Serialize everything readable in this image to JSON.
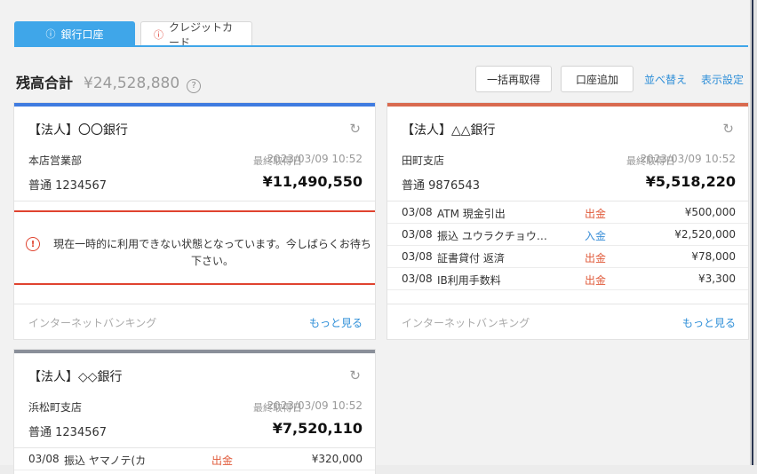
{
  "tabs": [
    {
      "label": "銀行口座",
      "icon": "info-icon",
      "active": true
    },
    {
      "label": "クレジットカード",
      "icon": "alert-icon",
      "active": false
    }
  ],
  "summary": {
    "label": "残高合計",
    "amount": "¥24,528,880",
    "help_icon": "question-icon"
  },
  "actions": {
    "refetch_all": "一括再取得",
    "add_account": "口座追加",
    "sort": "並べ替え",
    "display_settings": "表示設定"
  },
  "colors": {
    "accent": "#3fa6e9",
    "card1": "#3f7be0",
    "card2": "#d96a4f",
    "card3": "#8a8f99",
    "error": "#e0432f",
    "withdrawal": "#e05a3a",
    "deposit": "#3b8fd8"
  },
  "cards": [
    {
      "title": "【法人】〇〇銀行",
      "branch": "本店営業部",
      "last_fetched_label": "最終取得日",
      "last_fetched": "2023/03/09 10:52",
      "account": "普通 1234567",
      "balance": "¥11,490,550",
      "error_message": "現在一時的に利用できない状態となっています。今しばらくお待ち下さい。",
      "service": "インターネットバンキング",
      "more": "もっと見る"
    },
    {
      "title": "【法人】△△銀行",
      "branch": "田町支店",
      "last_fetched_label": "最終取得日",
      "last_fetched": "2023/03/09 10:52",
      "account": "普通 9876543",
      "balance": "¥5,518,220",
      "transactions": [
        {
          "date": "03/08",
          "desc": "ATM 現金引出",
          "type": "出金",
          "amount": "¥500,000"
        },
        {
          "date": "03/08",
          "desc": "振込 ユウラクチョウ…",
          "type": "入金",
          "amount": "¥2,520,000"
        },
        {
          "date": "03/08",
          "desc": "証書貸付 返済",
          "type": "出金",
          "amount": "¥78,000"
        },
        {
          "date": "03/08",
          "desc": "IB利用手数料",
          "type": "出金",
          "amount": "¥3,300"
        }
      ],
      "service": "インターネットバンキング",
      "more": "もっと見る"
    },
    {
      "title": "【法人】◇◇銀行",
      "branch": "浜松町支店",
      "last_fetched_label": "最終取得日",
      "last_fetched": "2023/03/09 10:52",
      "account": "普通 1234567",
      "balance": "¥7,520,110",
      "transactions": [
        {
          "date": "03/08",
          "desc": "振込 ヤマノテ(カ",
          "type": "出金",
          "amount": "¥320,000"
        }
      ]
    }
  ]
}
